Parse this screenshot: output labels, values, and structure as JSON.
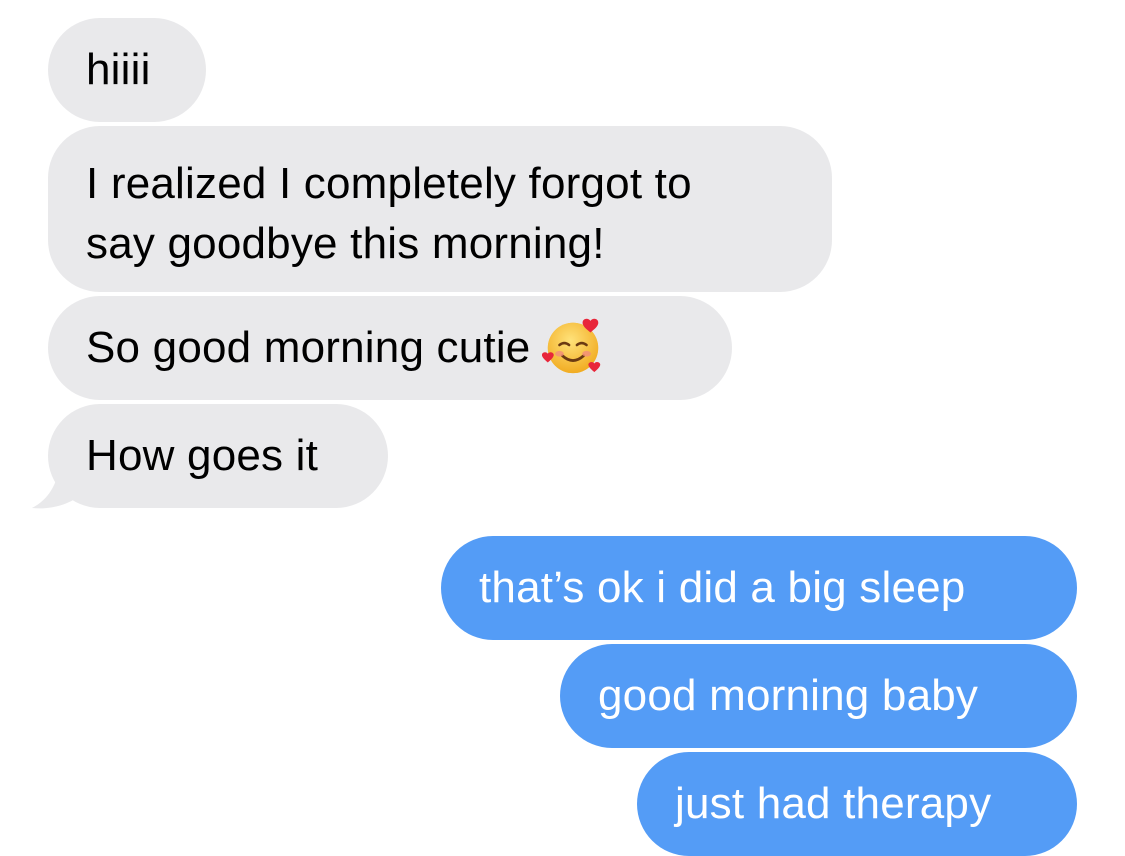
{
  "conversation": {
    "incoming": [
      {
        "text": "hiiii"
      },
      {
        "line1": "I realized I completely forgot to",
        "line2": "say goodbye this morning!"
      },
      {
        "text": "So good morning cutie",
        "emoji": "smiling-face-with-hearts-emoji"
      },
      {
        "text": "How goes it"
      }
    ],
    "outgoing": [
      {
        "text": "that’s ok i did a big sleep"
      },
      {
        "text": "good morning baby"
      },
      {
        "text": "just had therapy"
      }
    ]
  },
  "colors": {
    "incoming_bubble": "#e9e9eb",
    "outgoing_bubble": "#549cf6",
    "incoming_text": "#000000",
    "outgoing_text": "#ffffff",
    "background": "#ffffff"
  }
}
